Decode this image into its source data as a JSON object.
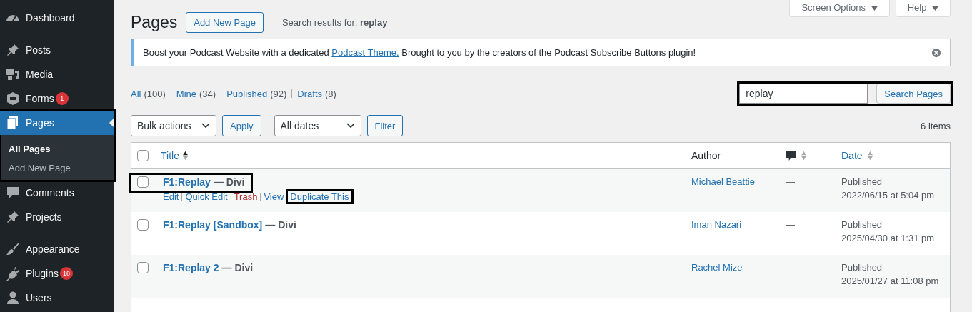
{
  "sidebar": {
    "groups": [
      [
        {
          "label": "Dashboard",
          "kind": "gauge",
          "selected": false,
          "highlighted": false
        }
      ],
      [
        {
          "label": "Posts",
          "kind": "pin",
          "selected": false,
          "highlighted": false
        },
        {
          "label": "Media",
          "kind": "media",
          "selected": false,
          "highlighted": false
        },
        {
          "label": "Forms",
          "kind": "forms",
          "badge": "1",
          "selected": false,
          "highlighted": false
        },
        {
          "label": "Pages",
          "kind": "pages",
          "selected": true,
          "highlighted": true,
          "submenu": [
            {
              "label": "All Pages",
              "selected": true
            },
            {
              "label": "Add New Page",
              "selected": false
            }
          ]
        },
        {
          "label": "Comments",
          "kind": "comment",
          "selected": false,
          "highlighted": false
        },
        {
          "label": "Projects",
          "kind": "pin",
          "selected": false,
          "highlighted": false
        }
      ],
      [
        {
          "label": "Appearance",
          "kind": "brush",
          "selected": false,
          "highlighted": false
        },
        {
          "label": "Plugins",
          "kind": "plug",
          "badge": "18",
          "selected": false,
          "highlighted": false
        },
        {
          "label": "Users",
          "kind": "user",
          "selected": false,
          "highlighted": false
        }
      ]
    ]
  },
  "screen_tabs": [
    {
      "label": "Screen Options"
    },
    {
      "label": "Help"
    }
  ],
  "header": {
    "title": "Pages",
    "add_button": "Add New Page",
    "search_note": "Search results for: **replay**"
  },
  "notice": {
    "before": "Boost your Podcast Website with a dedicated",
    "link": "Podcast Theme.",
    "after": "Brought to you by the creators of the Podcast Subscribe Buttons plugin!"
  },
  "views": [
    {
      "label": "All",
      "count": "(100)"
    },
    {
      "label": "Mine",
      "count": "(34)"
    },
    {
      "label": "Published",
      "count": "(92)"
    },
    {
      "label": "Drafts",
      "count": "(8)"
    }
  ],
  "search": {
    "value": "replay",
    "button": "Search Pages",
    "highlighted": true
  },
  "tablenav": {
    "bulk": "Bulk actions",
    "apply": "Apply",
    "dates": "All dates",
    "filter": "Filter",
    "count": "6 items"
  },
  "table": {
    "select_all": {
      "checked": false
    },
    "columns": {
      "title": "Title",
      "author": "Author",
      "date": "Date"
    },
    "rows": [
      {
        "checked": false,
        "title": "F1:Replay",
        "state": "— Divi",
        "highlighted": true,
        "author": "Michael Beattie",
        "comments": "—",
        "status": "Published",
        "date": "2022/06/15 at 5:04 pm",
        "actions": [
          {
            "label": "Edit",
            "kind": "link",
            "highlighted": false
          },
          {
            "label": "Quick Edit",
            "kind": "link",
            "highlighted": false
          },
          {
            "label": "Trash",
            "kind": "delete",
            "highlighted": false
          },
          {
            "label": "View",
            "kind": "link",
            "highlighted": false
          },
          {
            "label": "Duplicate This",
            "kind": "link",
            "highlighted": true
          }
        ]
      },
      {
        "checked": false,
        "title": "F1:Replay [Sandbox]",
        "state": "— Divi",
        "highlighted": false,
        "author": "Iman Nazari",
        "comments": "—",
        "status": "Published",
        "date": "2025/04/30 at 1:31 pm"
      },
      {
        "checked": false,
        "title": "F1:Replay 2",
        "state": "— Divi",
        "highlighted": false,
        "author": "Rachel Mize",
        "comments": "—",
        "status": "Published",
        "date": "2025/01/27 at 11:08 pm"
      }
    ]
  }
}
